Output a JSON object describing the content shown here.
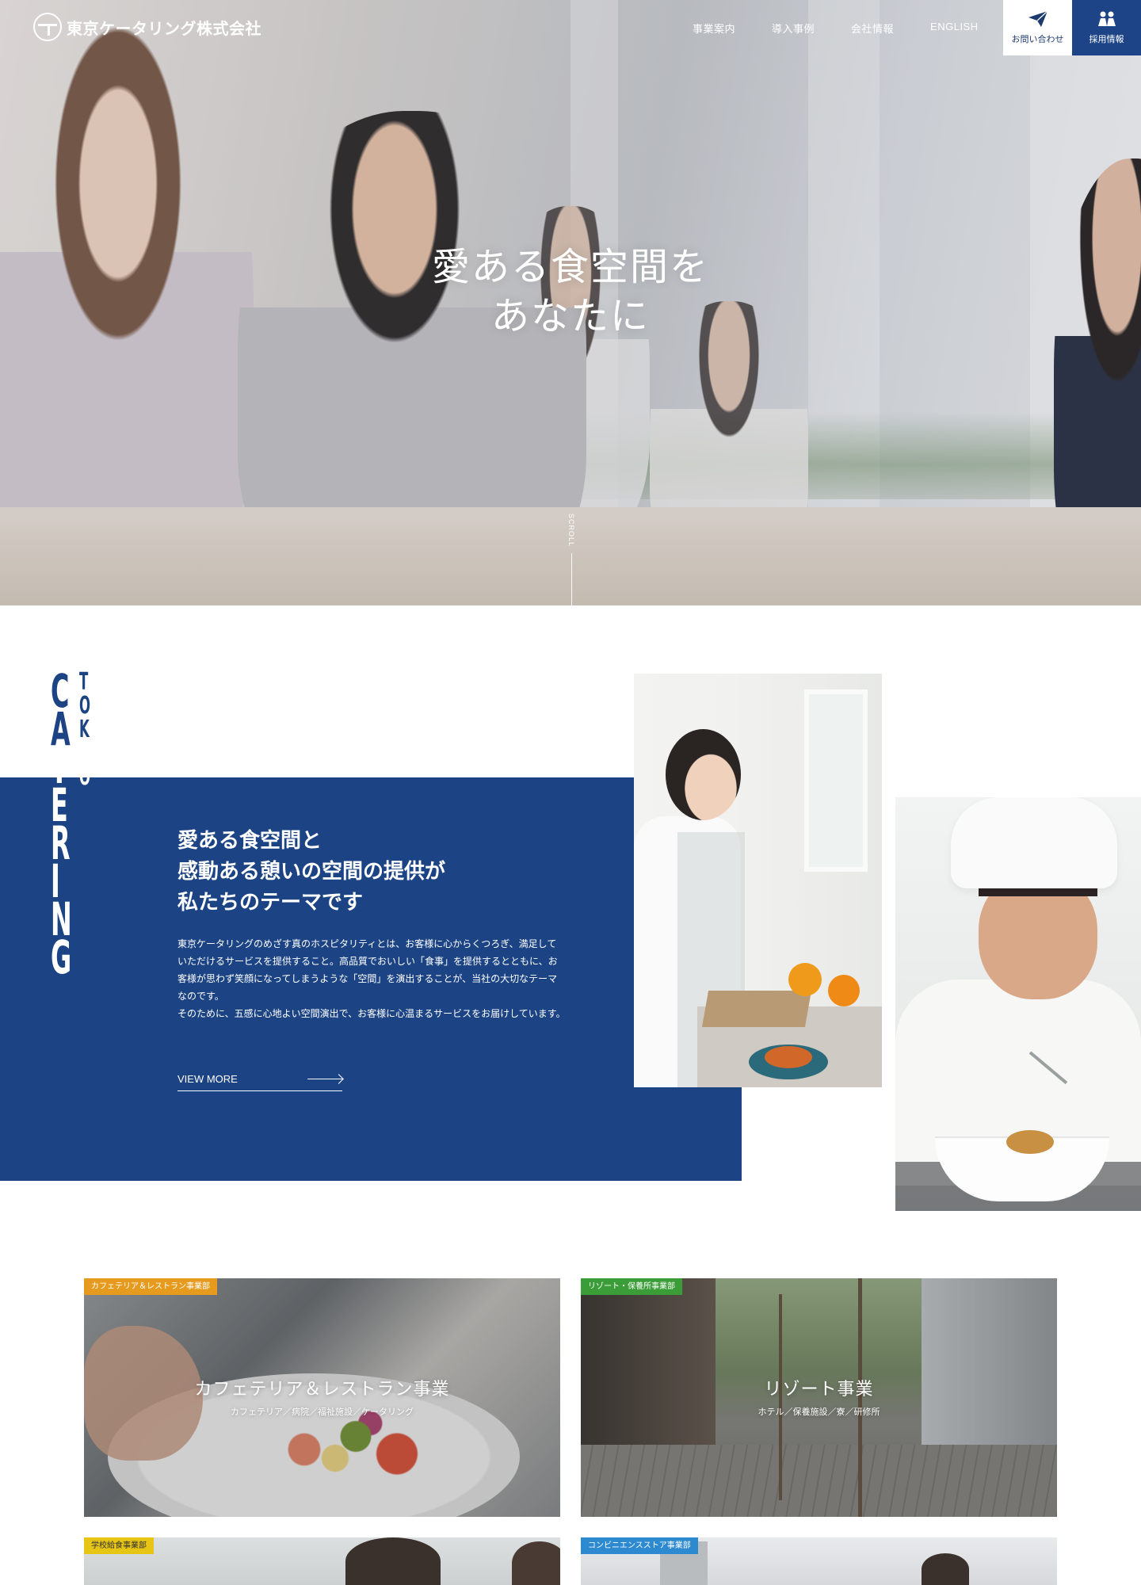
{
  "header": {
    "logo_text": "東京ケータリング株式会社",
    "nav": [
      {
        "label": "事業案内"
      },
      {
        "label": "導入事例"
      },
      {
        "label": "会社情報"
      },
      {
        "label": "ENGLISH"
      }
    ],
    "contact_label": "お問い合わせ",
    "contact_icon": "paper-plane-icon",
    "recruit_label": "採用情報",
    "recruit_icon": "people-icon",
    "recruit_color": "#1d4486"
  },
  "hero": {
    "copy_line1": "愛ある食空間を",
    "copy_line2": "あなたに",
    "scroll_label": "SCROLL"
  },
  "about": {
    "vertical_word": "CATERING",
    "vertical_sub": "TOKYO",
    "heading_lines": [
      "愛ある食空間と",
      "感動ある憩いの空間の提供が",
      "私たちのテーマです"
    ],
    "body_p1": "東京ケータリングのめざす真のホスピタリティとは、お客様に心からくつろぎ、満足していただけるサービスを提供すること。高品質でおいしい「食事」を提供するとともに、お客様が思わず笑顔になってしまうような「空間」を演出することが、当社の大切なテーマなのです。",
    "body_p2": "そのために、五感に心地よい空間演出で、お客様に心温まるサービスをお届けしています。",
    "view_more": "VIEW MORE",
    "band_color": "#1c4485"
  },
  "business": [
    {
      "tag": "カフェテリア＆レストラン事業部",
      "title": "カフェテリア＆レストラン事業",
      "sub": "カフェテリア／病院／福祉施設／ケータリング",
      "tag_color": "#e69b1e"
    },
    {
      "tag": "リゾート・保養所事業部",
      "title": "リゾート事業",
      "sub": "ホテル／保養施設／寮／研修所",
      "tag_color": "#3a9d37"
    },
    {
      "tag": "学校給食事業部",
      "title": "",
      "sub": "",
      "tag_color": "#e7c515"
    },
    {
      "tag": "コンビニエンスストア事業部",
      "title": "",
      "sub": "",
      "tag_color": "#2e8ad0"
    }
  ]
}
